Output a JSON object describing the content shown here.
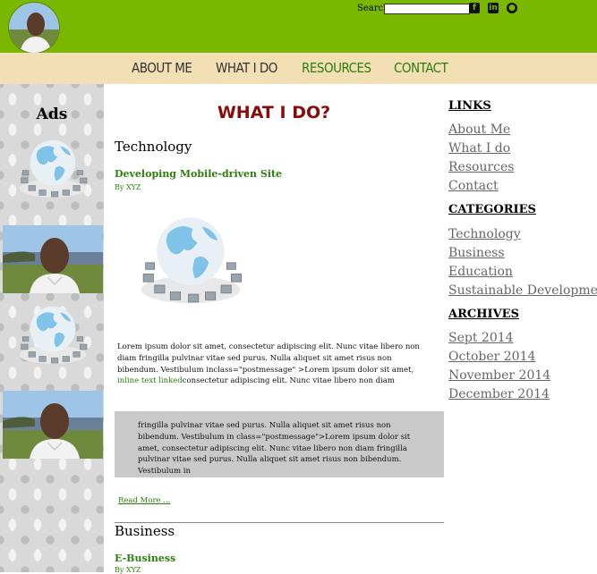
{
  "header": {
    "search_label": "Search:",
    "search_value": "",
    "social": [
      {
        "icon": "facebook-icon",
        "glyph": "f"
      },
      {
        "icon": "linkedin-icon",
        "glyph": "in"
      },
      {
        "icon": "github-icon",
        "glyph": "●"
      }
    ]
  },
  "nav": {
    "items": [
      {
        "label": "ABOUT ME",
        "color": "#333333"
      },
      {
        "label": "WHAT I DO",
        "color": "#333333"
      },
      {
        "label": "RESOURCES",
        "color": "#2e7d0f"
      },
      {
        "label": "CONTACT",
        "color": "#2e7d0f"
      }
    ]
  },
  "sidebar_left": {
    "title": "Ads"
  },
  "main": {
    "page_title": "WHAT I DO?",
    "sections": [
      {
        "heading": "Technology",
        "post_title": "Developing Mobile-driven Site",
        "author": "By XYZ"
      },
      {
        "heading": "Business",
        "post_title": "E-Business",
        "author": "By XYZ"
      }
    ],
    "post_text_1": "Lorem ipsum dolor sit amet, consectetur adipiscing elit. Nunc vitae libero non diam fringilla pulvinar vitae sed purus. Nulla aliquet sit amet risus non bibendum. Vestibulum inclass=\"postmessage\" >Lorem ipsum dolor sit amet, ",
    "inline_link": "inline text linked",
    "post_text_2": "consectetur adipiscing elit. Nunc vitae libero non diam",
    "quote": "fringilla pulvinar vitae sed purus. Nulla aliquet sit amet risus non bibendum. Vestibulum in class=\"postmessage\">Lorem ipsum dolor sit amet, consectetur adipiscing elit. Nunc vitae libero non diam fringilla pulvinar vitae sed purus. Nulla aliquet sit amet risus non bibendum. Vestibulum in",
    "read_more": "Read More ..."
  },
  "sidebar_right": {
    "links_title": "LINKS",
    "links": [
      "About Me",
      "What I do",
      "Resources",
      "Contact"
    ],
    "categories_title": "CATEGORIES",
    "categories": [
      "Technology",
      "Business",
      "Education",
      "Sustainable Development"
    ],
    "archives_title": "ARCHIVES",
    "archives": [
      "Sept 2014",
      "October 2014",
      "November 2014",
      "December 2014"
    ]
  },
  "colors": {
    "header_bg": "#7ab800",
    "nav_bg": "#f3dfb4",
    "title_red": "#8b0a0a",
    "link_green": "#2e7d0f"
  }
}
